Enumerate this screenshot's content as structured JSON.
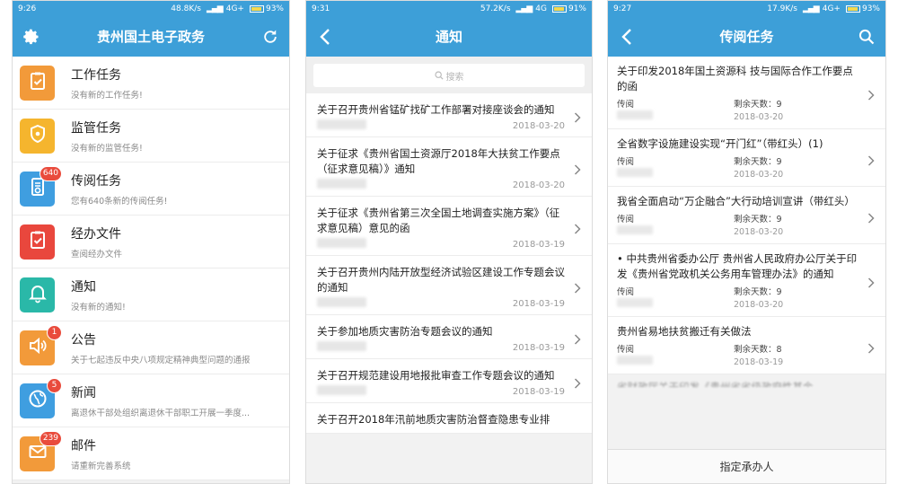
{
  "p1": {
    "status": {
      "time": "9:26",
      "net": "48.8K/s",
      "signal": "4G+",
      "battery": "93%",
      "battery_level": 0.93
    },
    "title": "贵州国土电子政务",
    "left_icon": "gear-icon",
    "right_icon": "refresh-icon",
    "items": [
      {
        "title": "工作任务",
        "sub": "没有新的工作任务!",
        "color": "#f29a3a",
        "icon": "clipboard-check-icon",
        "badge": ""
      },
      {
        "title": "监管任务",
        "sub": "没有新的监管任务!",
        "color": "#f5b52e",
        "icon": "shield-icon",
        "badge": ""
      },
      {
        "title": "传阅任务",
        "sub": "您有640条新的传阅任务!",
        "color": "#3f9ee0",
        "icon": "circulate-document-icon",
        "badge": "640"
      },
      {
        "title": "经办文件",
        "sub": "查阅经办文件",
        "color": "#e9473d",
        "icon": "file-check-icon",
        "badge": ""
      },
      {
        "title": "通知",
        "sub": "没有新的通知!",
        "color": "#2ab8a8",
        "icon": "bell-icon",
        "badge": ""
      },
      {
        "title": "公告",
        "sub": "关于七起违反中央八项规定精神典型问题的通报",
        "color": "#f29a3a",
        "icon": "speaker-icon",
        "badge": "1"
      },
      {
        "title": "新闻",
        "sub": "离退休干部处组织离退休干部职工开展一季度...",
        "color": "#3f9ee0",
        "icon": "globe-icon",
        "badge": "5"
      },
      {
        "title": "邮件",
        "sub": "请重新完善系统",
        "color": "#f29a3a",
        "icon": "mail-icon",
        "badge": "239"
      }
    ]
  },
  "p2": {
    "status": {
      "time": "9:31",
      "net": "57.2K/s",
      "signal": "4G",
      "battery": "91%",
      "battery_level": 0.91
    },
    "title": "通知",
    "back_icon": "back-arrow-icon",
    "search_placeholder": "搜索",
    "items": [
      {
        "title": "关于召开贵州省锰矿找矿工作部署对接座谈会的通知",
        "date": "2018-03-20"
      },
      {
        "title": "关于征求《贵州省国土资源厅2018年大扶贫工作要点（征求意见稿）》通知",
        "date": "2018-03-20"
      },
      {
        "title": "关于征求《贵州省第三次全国土地调查实施方案》（征求意见稿）意见的函",
        "date": "2018-03-19"
      },
      {
        "title": "关于召开贵州内陆开放型经济试验区建设工作专题会议的通知",
        "date": "2018-03-19"
      },
      {
        "title": "关于参加地质灾害防治专题会议的通知",
        "date": "2018-03-19"
      },
      {
        "title": "关于召开规范建设用地报批审查工作专题会议的通知",
        "date": "2018-03-19"
      },
      {
        "title": "关于召开2018年汛前地质灾害防治督查隐患专业排",
        "date": ""
      }
    ]
  },
  "p3": {
    "status": {
      "time": "9:27",
      "net": "17.9K/s",
      "signal": "4G+",
      "battery": "93%",
      "battery_level": 0.93
    },
    "title": "传阅任务",
    "back_icon": "back-arrow-icon",
    "search_icon": "search-icon",
    "items": [
      {
        "title": "关于印发2018年国土资源科 技与国际合作工作要点的函",
        "type": "传阅",
        "remain_label": "剩余天数：9",
        "date": "2018-03-20"
      },
      {
        "title": "全省数字设施建设实现“开门红”（带红头）(1)",
        "type": "传阅",
        "remain_label": "剩余天数：9",
        "date": "2018-03-20"
      },
      {
        "title": "我省全面启动“万企融合”大行动培训宣讲（带红头）",
        "type": "传阅",
        "remain_label": "剩余天数：9",
        "date": "2018-03-20"
      },
      {
        "title": "• 中共贵州省委办公厅 贵州省人民政府办公厅关于印发《贵州省党政机关公务用车管理办法》的通知",
        "type": "传阅",
        "remain_label": "剩余天数：9",
        "date": "2018-03-20"
      },
      {
        "title": "贵州省易地扶贫搬迁有关做法",
        "type": "传阅",
        "remain_label": "剩余天数：8",
        "date": "2018-03-19"
      }
    ],
    "cut_row": "省财政厅关于印发《贵州省省级政府性基金...",
    "footer": "指定承办人"
  }
}
